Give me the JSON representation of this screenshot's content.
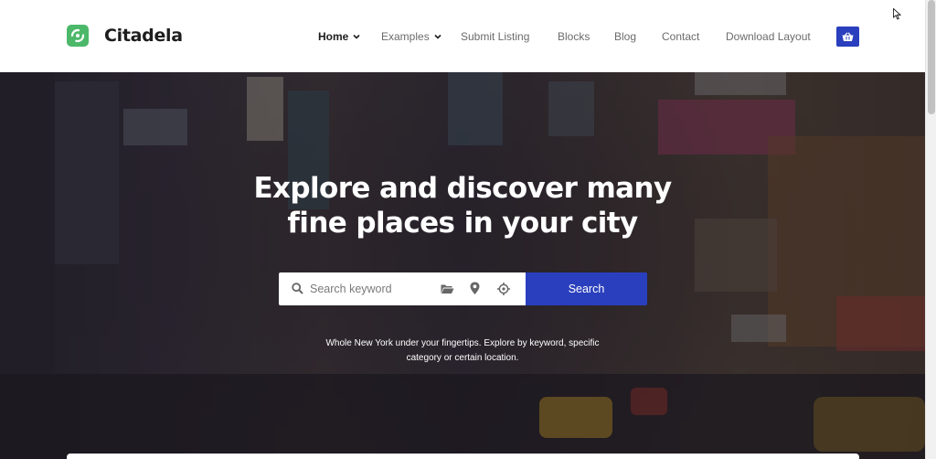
{
  "brand": {
    "name": "Citadela",
    "accent": "#4cb86a"
  },
  "nav": {
    "items": [
      {
        "label": "Home",
        "dropdown": true,
        "active": true
      },
      {
        "label": "Examples",
        "dropdown": true,
        "active": false
      },
      {
        "label": "Submit Listing",
        "dropdown": false,
        "active": false
      },
      {
        "label": "Blocks",
        "dropdown": false,
        "active": false
      },
      {
        "label": "Blog",
        "dropdown": false,
        "active": false
      },
      {
        "label": "Contact",
        "dropdown": false,
        "active": false
      },
      {
        "label": "Download Layout",
        "dropdown": false,
        "active": false
      }
    ],
    "cart_icon": "basket-icon"
  },
  "hero": {
    "title_line1": "Explore and discover many",
    "title_line2": "fine places in your city",
    "search": {
      "placeholder": "Search keyword",
      "value": "",
      "category_icon": "folder-icon",
      "location_icon": "map-pin-icon",
      "geolocate_icon": "crosshair-icon",
      "button_label": "Search"
    },
    "desc_line1": "Whole New York under your fingertips. Explore by keyword, specific",
    "desc_line2": "category or certain location."
  },
  "colors": {
    "primary": "#2a3fbd",
    "heading": "#1d1d1d",
    "nav_text": "#6b6b6b"
  }
}
